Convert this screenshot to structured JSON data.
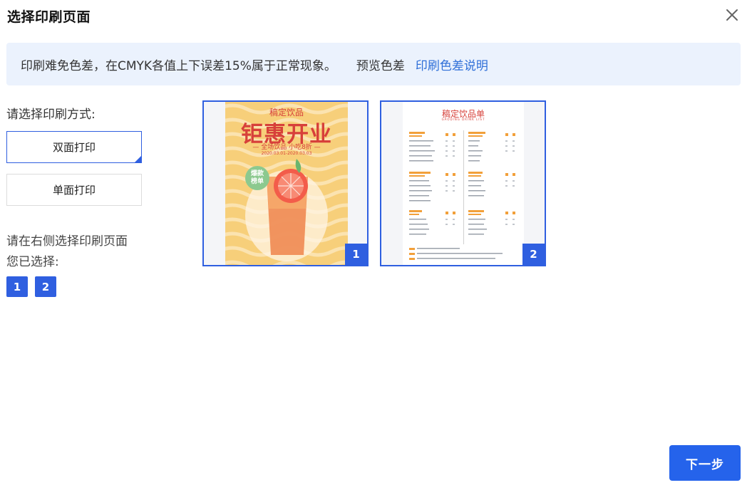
{
  "dialog": {
    "title": "选择印刷页面",
    "close_icon": "close-icon"
  },
  "notice": {
    "text": "印刷难免色差，在CMYK各值上下误差15%属于正常现象。",
    "preview_label": "预览色差",
    "link_text": "印刷色差说明"
  },
  "method": {
    "label": "请选择印刷方式:",
    "options": [
      {
        "label": "双面打印",
        "selected": true
      },
      {
        "label": "单面打印",
        "selected": false
      }
    ]
  },
  "selection": {
    "hint": "请在右侧选择印刷页面",
    "selected_label": "您已选择:",
    "chips": [
      "1",
      "2"
    ]
  },
  "pages": [
    {
      "number": "1",
      "poster": {
        "subtitle": "稿定饮品",
        "title": "钜惠开业",
        "tagline": "— 全场饮品 小吃8折 —",
        "date": "2020.03.01-2020.03.03",
        "badge": "爆款\n榜单"
      }
    },
    {
      "number": "2",
      "menu": {
        "title": "稿定饮品单",
        "subtitle": "GAODING DRINK LIST"
      }
    }
  ],
  "footer": {
    "next_label": "下一步"
  },
  "colors": {
    "accent": "#2f5fe0",
    "notice_bg": "#ebf2fd",
    "link": "#2f6fd8",
    "poster_bg": "#f7cf7a",
    "poster_red": "#d7403a",
    "next_button": "#2563eb"
  }
}
